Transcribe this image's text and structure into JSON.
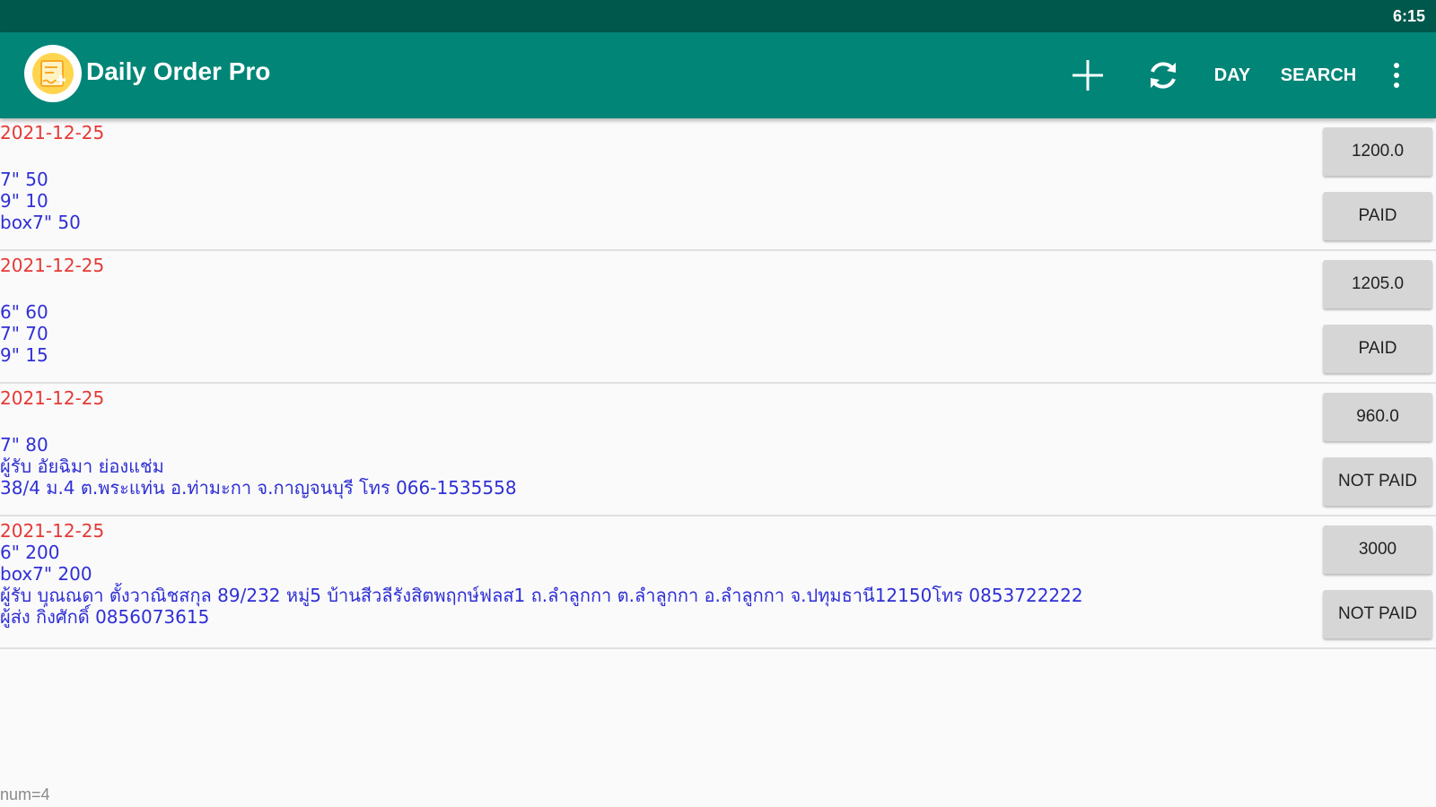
{
  "status_bar": {
    "time": "6:15"
  },
  "app_bar": {
    "title": "Daily Order Pro",
    "actions": {
      "day": "DAY",
      "search": "SEARCH"
    }
  },
  "orders": [
    {
      "date": "2021-12-25",
      "lines": [
        "",
        "7\" 50",
        "9\" 10",
        "box7\" 50"
      ],
      "amount": "1200.0",
      "status": "PAID"
    },
    {
      "date": "2021-12-25",
      "lines": [
        "",
        "6\" 60",
        "7\" 70",
        "9\" 15"
      ],
      "amount": "1205.0",
      "status": "PAID"
    },
    {
      "date": "2021-12-25",
      "lines": [
        "",
        "7\" 80",
        "ผู้รับ อัยฉิมา ย่องแช่ม",
        "38/4 ม.4 ต.พระแท่น อ.ท่ามะกา จ.กาญจนบุรี โทร 066-1535558"
      ],
      "amount": "960.0",
      "status": "NOT PAID"
    },
    {
      "date": "2021-12-25",
      "lines": [
        "6\" 200",
        "box7\" 200",
        "ผู้รับ บุณณดา ตั้งวาณิชสกุล 89/232 หมู่5 บ้านสีวลีรังสิตพฤกษ์ฟลส1 ถ.ลำลูกกา ต.ลำลูกกา อ.ลำลูกกา จ.ปทุมธานี12150โทร 0853722222",
        "ผู้ส่ง กิ่งศักดิ์ 0856073615"
      ],
      "amount": "3000",
      "status": "NOT PAID"
    }
  ],
  "footer": {
    "count": "num=4"
  }
}
